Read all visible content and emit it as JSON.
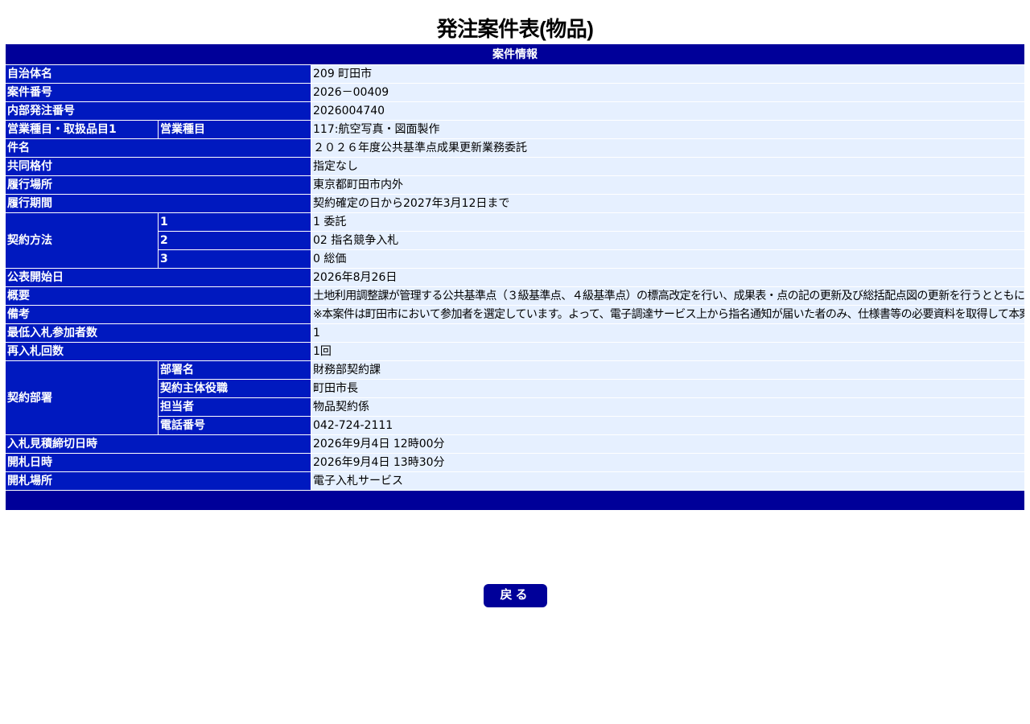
{
  "title": "発注案件表(物品)",
  "section_header": "案件情報",
  "labels": {
    "municipality": "自治体名",
    "case_number": "案件番号",
    "internal_order_number": "内部発注番号",
    "business_category": "営業種目・取扱品目1",
    "business_category_sub": "営業種目",
    "subject": "件名",
    "joint_rating": "共同格付",
    "location": "履行場所",
    "period": "履行期間",
    "contract_method": "契約方法",
    "contract_method_1": "1",
    "contract_method_2": "2",
    "contract_method_3": "3",
    "publish_date": "公表開始日",
    "summary": "概要",
    "remarks": "備考",
    "min_bidders": "最低入札参加者数",
    "rebid_count": "再入札回数",
    "contract_dept": "契約部署",
    "dept_name": "部署名",
    "contract_principal": "契約主体役職",
    "person_in_charge": "担当者",
    "phone": "電話番号",
    "bid_deadline": "入札見積締切日時",
    "opening_datetime": "開札日時",
    "opening_place": "開札場所"
  },
  "values": {
    "municipality": "209 町田市",
    "case_number": "2026－00409",
    "internal_order_number": "2026004740",
    "business_category": "117:航空写真・図面製作",
    "subject": "２０２６年度公共基準点成果更新業務委託",
    "joint_rating": "指定なし",
    "location": "東京都町田市内外",
    "period": "契約確定の日から2027年3月12日まで",
    "contract_method_1": "1 委託",
    "contract_method_2": "02 指名競争入札",
    "contract_method_3": "0 総価",
    "publish_date": "2026年8月26日",
    "summary": "土地利用調整課が管理する公共基準点（３級基準点、４級基準点）の標高改定を行い、成果表・点の記の更新及び総括配点図の更新を行うとともに、基準点検索図（閲覧用の配点図に検索機能を付加したもの）の更新を行う業務を委託するもの。",
    "remarks": "※本案件は町田市において参加者を選定しています。よって、電子調達サービス上から指名通知が届いた者のみ、仕様書等の必要資料を取得して本案件の入札又は見積に参加することができます。（希望申請を受ける方法ではありません。）指名通知は原則、公表日中に送信する予定ですが、事情により遅れることがあります。",
    "min_bidders": "1",
    "rebid_count": "1回",
    "dept_name": "財務部契約課",
    "contract_principal": "町田市長",
    "person_in_charge": "物品契約係",
    "phone": "042-724-2111",
    "bid_deadline": "2026年9月4日 12時00分",
    "opening_datetime": "2026年9月4日 13時30分",
    "opening_place": "電子入札サービス"
  },
  "buttons": {
    "back": "戻る"
  },
  "colors": {
    "header_navy": "#000099",
    "label_blue": "#0019bf",
    "value_bg": "#e6f0ff"
  }
}
